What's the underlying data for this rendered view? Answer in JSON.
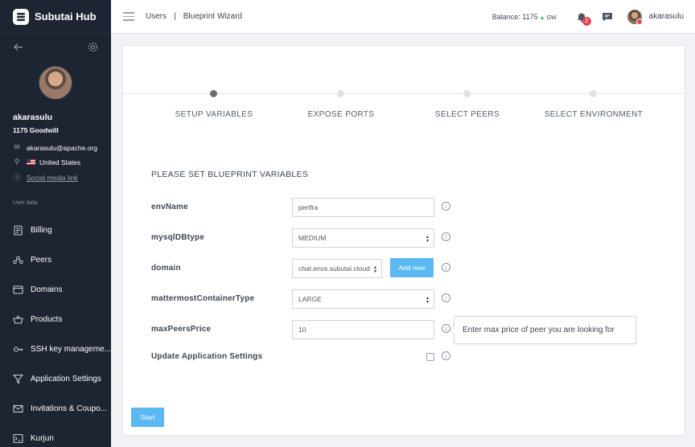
{
  "app": {
    "name": "Subutai Hub"
  },
  "profile": {
    "name": "akarasulu",
    "balance": "1175 Goodwill",
    "email": "akarasulu@apache.org",
    "country": "United States",
    "social_link": "Social media link"
  },
  "sidebar": {
    "section_label": "User data",
    "items": [
      {
        "label": "Billing",
        "icon": "billing-icon"
      },
      {
        "label": "Peers",
        "icon": "peers-icon"
      },
      {
        "label": "Domains",
        "icon": "domains-icon"
      },
      {
        "label": "Products",
        "icon": "products-icon"
      },
      {
        "label": "SSH key manageme...",
        "icon": "ssh-key-icon"
      },
      {
        "label": "Application Settings",
        "icon": "filter-icon"
      },
      {
        "label": "Invitations & Coupo...",
        "icon": "envelope-icon"
      },
      {
        "label": "Kurjun",
        "icon": "terminal-icon"
      }
    ]
  },
  "header": {
    "breadcrumb": [
      "Users",
      "Blueprint Wizard"
    ],
    "balance_label": "Balance: 1175",
    "balance_unit": "GW",
    "notification_count": "2",
    "username": "akarasulu"
  },
  "wizard": {
    "steps": [
      "SETUP VARIABLES",
      "EXPOSE PORTS",
      "SELECT PEERS",
      "SELECT ENVIRONMENT"
    ],
    "active_step": 0,
    "form_title": "PLEASE SET BLUEPRINT VARIABLES",
    "fields": {
      "envName": {
        "label": "envName",
        "value": "perifra"
      },
      "mysqlDBtype": {
        "label": "mysqlDBtype",
        "value": "MEDIUM"
      },
      "domain": {
        "label": "domain",
        "value": "chat.envs.subutai.cloud",
        "add_label": "Add new"
      },
      "mattermostContainerType": {
        "label": "mattermostContainerType",
        "value": "LARGE"
      },
      "maxPeersPrice": {
        "label": "maxPeersPrice",
        "value": "10",
        "tooltip": "Enter max price of peer you are looking for"
      },
      "updateSettings": {
        "label": "Update Application Settings",
        "checked": false
      }
    },
    "start_label": "Start",
    "info_glyph": "i"
  }
}
